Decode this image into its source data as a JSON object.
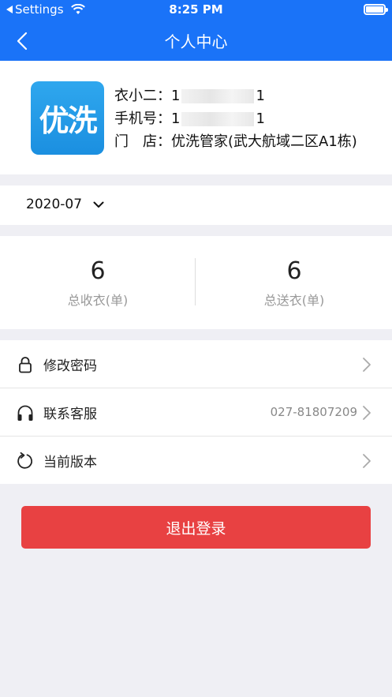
{
  "status_bar": {
    "back_app": "Settings",
    "time": "8:25 PM"
  },
  "nav": {
    "title": "个人中心"
  },
  "profile": {
    "logo_text": "优洗",
    "rows": [
      {
        "label": "衣小二：",
        "value_prefix": "1",
        "value_suffix": "1"
      },
      {
        "label": "手机号：",
        "value_prefix": "1",
        "value_suffix": "1"
      },
      {
        "label": "门　店：",
        "value": "优洗管家(武大航域二区A1栋)"
      }
    ]
  },
  "date_filter": {
    "value": "2020-07"
  },
  "stats": {
    "received": {
      "value": "6",
      "label": "总收衣(单)"
    },
    "delivered": {
      "value": "6",
      "label": "总送衣(单)"
    }
  },
  "menu": [
    {
      "label": "修改密码",
      "icon": "lock-icon"
    },
    {
      "label": "联系客服",
      "icon": "headphones-icon",
      "value": "027-81807209"
    },
    {
      "label": "当前版本",
      "icon": "refresh-icon"
    }
  ],
  "logout": {
    "label": "退出登录"
  },
  "colors": {
    "primary": "#1a73f8",
    "danger": "#e84142",
    "background": "#efeff4"
  }
}
